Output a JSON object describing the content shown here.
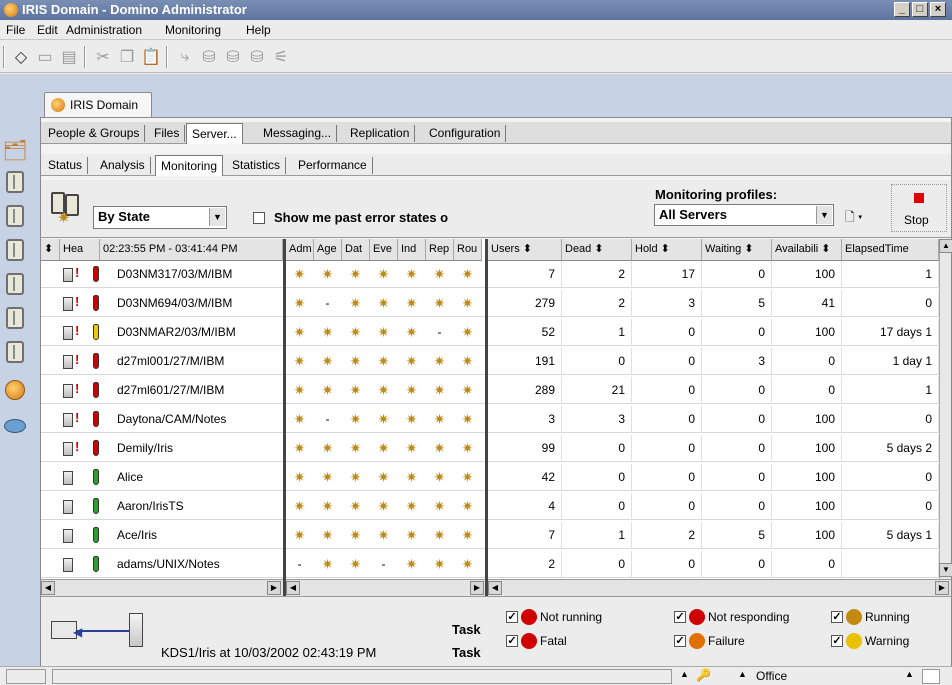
{
  "window": {
    "title": "IRIS Domain - Domino Administrator",
    "controls": [
      "_",
      "□",
      "×"
    ]
  },
  "menu": [
    "File",
    "Edit",
    "Administration",
    "Monitoring",
    "Help"
  ],
  "workspace_tab": "IRIS Domain",
  "main_tabs": [
    "People & Groups",
    "Files",
    "Server...",
    "Messaging...",
    "Replication",
    "Configuration"
  ],
  "sub_tabs": [
    "Status",
    "Analysis",
    "Monitoring",
    "Statistics",
    "Performance"
  ],
  "controls": {
    "view_select": "By State",
    "show_past_label": "Show me past error states o",
    "profiles_label": "Monitoring profiles:",
    "profile_select": "All Servers",
    "stop_label": "Stop"
  },
  "grid": {
    "left_headers": [
      "⬍",
      "Hea",
      "02:23:55 PM - 03:41:44 PM"
    ],
    "task_headers": [
      "Adm",
      "Age",
      "Dat",
      "Eve",
      "Ind",
      "Rep",
      "Rou"
    ],
    "stat_headers": [
      "Users ⬍",
      "Dead ⬍",
      "Hold ⬍",
      "Waiting ⬍",
      "Availabili ⬍",
      "ElapsedTime"
    ],
    "rows": [
      {
        "name": "D03NM317/03/M/IBM",
        "alert": true,
        "health": "red",
        "tasks": [
          "g",
          "g",
          "g",
          "g",
          "g",
          "g",
          "g"
        ],
        "users": "7",
        "dead": "2",
        "hold": "17",
        "waiting": "0",
        "avail": "100",
        "elapsed": "1"
      },
      {
        "name": "D03NM694/03/M/IBM",
        "alert": true,
        "health": "red",
        "tasks": [
          "g",
          "-",
          "g",
          "g",
          "g",
          "g",
          "g"
        ],
        "users": "279",
        "dead": "2",
        "hold": "3",
        "waiting": "5",
        "avail": "41",
        "elapsed": "0"
      },
      {
        "name": "D03NMAR2/03/M/IBM",
        "alert": true,
        "health": "yellow",
        "tasks": [
          "g",
          "g",
          "g",
          "g",
          "g",
          "-",
          "g"
        ],
        "users": "52",
        "dead": "1",
        "hold": "0",
        "waiting": "0",
        "avail": "100",
        "elapsed": "17 days 1"
      },
      {
        "name": "d27ml001/27/M/IBM",
        "alert": true,
        "health": "red",
        "tasks": [
          "g",
          "g",
          "g",
          "g",
          "g",
          "g",
          "g"
        ],
        "users": "191",
        "dead": "0",
        "hold": "0",
        "waiting": "3",
        "avail": "0",
        "elapsed": "1 day 1"
      },
      {
        "name": "d27ml601/27/M/IBM",
        "alert": true,
        "health": "red",
        "tasks": [
          "g",
          "g",
          "g",
          "g",
          "g",
          "g",
          "g"
        ],
        "users": "289",
        "dead": "21",
        "hold": "0",
        "waiting": "0",
        "avail": "0",
        "elapsed": "1"
      },
      {
        "name": "Daytona/CAM/Notes",
        "alert": true,
        "health": "red",
        "tasks": [
          "g",
          "-",
          "g",
          "g",
          "g",
          "g",
          "g"
        ],
        "users": "3",
        "dead": "3",
        "hold": "0",
        "waiting": "0",
        "avail": "100",
        "elapsed": "0"
      },
      {
        "name": "Demily/Iris",
        "alert": true,
        "health": "red",
        "tasks": [
          "g",
          "g",
          "g",
          "g",
          "g",
          "g",
          "g"
        ],
        "users": "99",
        "dead": "0",
        "hold": "0",
        "waiting": "0",
        "avail": "100",
        "elapsed": "5 days 2"
      },
      {
        "name": "Alice",
        "alert": false,
        "health": "green",
        "tasks": [
          "g",
          "g",
          "g",
          "g",
          "g",
          "g",
          "g"
        ],
        "users": "42",
        "dead": "0",
        "hold": "0",
        "waiting": "0",
        "avail": "100",
        "elapsed": "0"
      },
      {
        "name": "Aaron/IrisTS",
        "alert": false,
        "health": "green",
        "tasks": [
          "g",
          "g",
          "g",
          "g",
          "g",
          "g",
          "g"
        ],
        "users": "4",
        "dead": "0",
        "hold": "0",
        "waiting": "0",
        "avail": "100",
        "elapsed": "0"
      },
      {
        "name": "Ace/Iris",
        "alert": false,
        "health": "green",
        "tasks": [
          "g",
          "g",
          "g",
          "g",
          "g",
          "g",
          "g"
        ],
        "users": "7",
        "dead": "1",
        "hold": "2",
        "waiting": "5",
        "avail": "100",
        "elapsed": "5 days 1"
      },
      {
        "name": "adams/UNIX/Notes",
        "alert": false,
        "health": "green",
        "tasks": [
          "-",
          "g",
          "g",
          "-",
          "g",
          "g",
          "g"
        ],
        "users": "2",
        "dead": "0",
        "hold": "0",
        "waiting": "0",
        "avail": "0",
        "elapsed": ""
      }
    ]
  },
  "bottom": {
    "server_status": "KDS1/Iris at 10/03/2002 02:43:19 PM",
    "task_label_1": "Task",
    "task_label_2": "Task",
    "legend": [
      {
        "label": "Not running",
        "icon": "not-running-icon",
        "color": "#d00000"
      },
      {
        "label": "Not responding",
        "icon": "stop-icon",
        "color": "#d00000"
      },
      {
        "label": "Running",
        "icon": "gear-icon",
        "color": "#c28a10"
      },
      {
        "label": "Fatal",
        "icon": "fatal-icon",
        "color": "#d00000"
      },
      {
        "label": "Failure",
        "icon": "failure-icon",
        "color": "#e07000"
      },
      {
        "label": "Warning",
        "icon": "warning-icon",
        "color": "#e8c000"
      }
    ]
  },
  "statusbar": {
    "location": "Office"
  }
}
